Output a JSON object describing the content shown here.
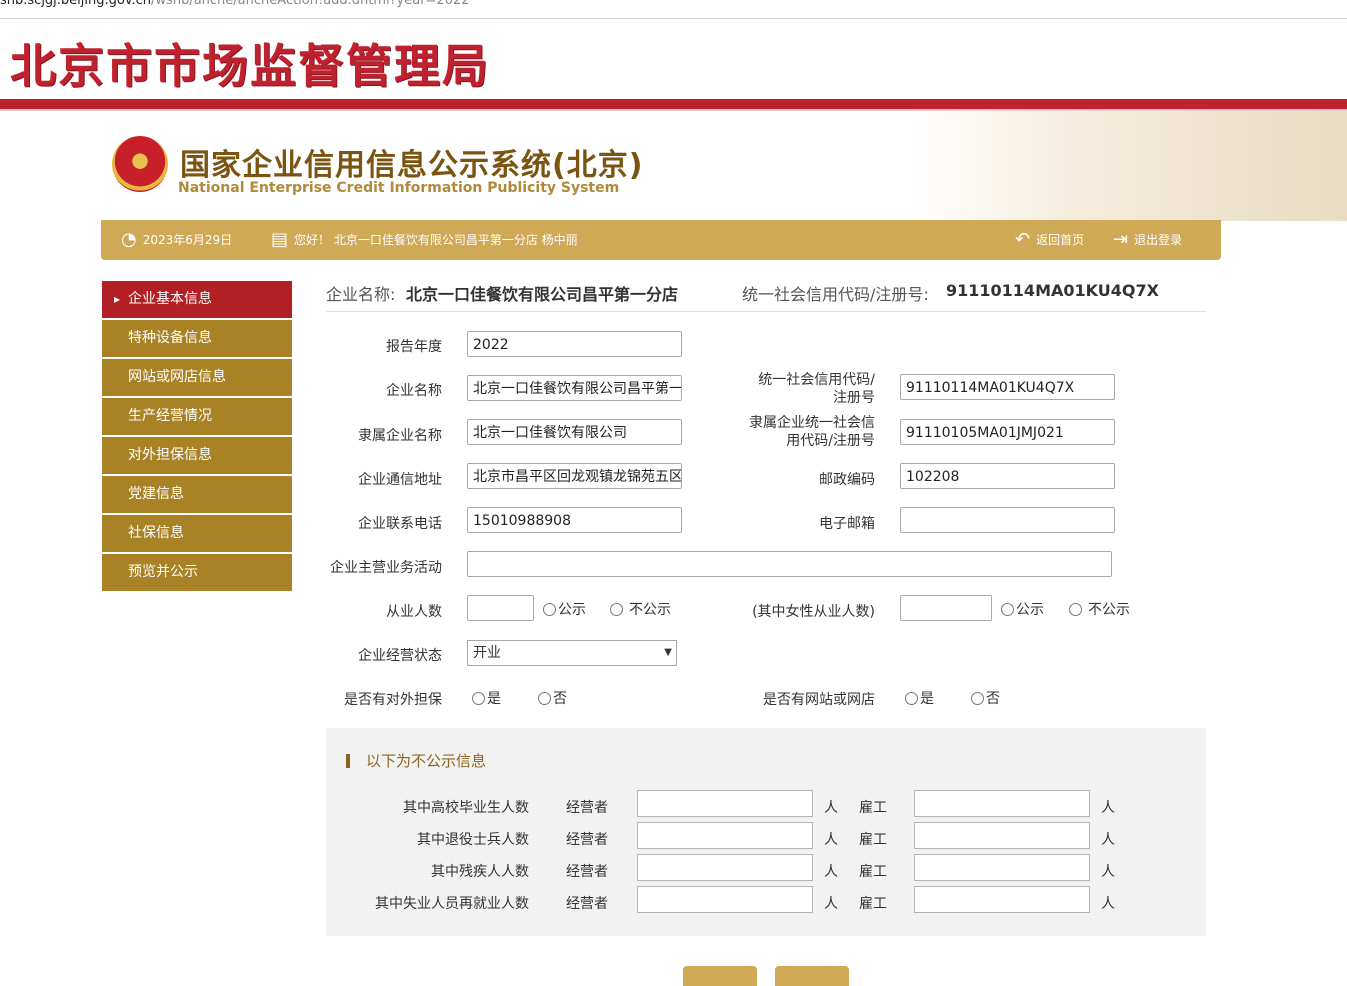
{
  "url": {
    "host": "snb.scjgj.beijing.gov.cn",
    "path": "/wsnb/anche/ancheAction!add.dhtml?year=2022"
  },
  "bureau_title": "北京市市场监督管理局",
  "system": {
    "title": "国家企业信用信息公示系统(北京)",
    "subtitle": "National Enterprise Credit Information Publicity System"
  },
  "topbar": {
    "date": "2023年6月29日",
    "greeting": "您好！ 北京一口佳餐饮有限公司昌平第一分店  杨中丽",
    "home": "返回首页",
    "logout": "退出登录"
  },
  "sidebar": {
    "items": [
      {
        "label": "企业基本信息",
        "active": true
      },
      {
        "label": "特种设备信息"
      },
      {
        "label": "网站或网店信息"
      },
      {
        "label": "生产经营情况"
      },
      {
        "label": "对外担保信息"
      },
      {
        "label": "党建信息"
      },
      {
        "label": "社保信息"
      },
      {
        "label": "预览并公示"
      }
    ]
  },
  "company_header": {
    "name_label": "企业名称:",
    "name": "北京一口佳餐饮有限公司昌平第一分店",
    "code_label": "统一社会信用代码/注册号:",
    "code": "91110114MA01KU4Q7X"
  },
  "form": {
    "report_year": {
      "label": "报告年度",
      "value": "2022"
    },
    "company_name": {
      "label": "企业名称",
      "value": "北京一口佳餐饮有限公司昌平第一"
    },
    "credit_code": {
      "label1": "统一社会信用代码/",
      "label2": "注册号",
      "value": "91110114MA01KU4Q7X"
    },
    "parent_name": {
      "label": "隶属企业名称",
      "value": "北京一口佳餐饮有限公司"
    },
    "parent_code": {
      "label1": "隶属企业统一社会信",
      "label2": "用代码/注册号",
      "value": "91110105MA01JMJ021"
    },
    "address": {
      "label": "企业通信地址",
      "value": "北京市昌平区回龙观镇龙锦苑五区"
    },
    "postcode": {
      "label": "邮政编码",
      "value": "102208"
    },
    "phone": {
      "label": "企业联系电话",
      "value": "15010988908"
    },
    "email": {
      "label": "电子邮箱",
      "value": ""
    },
    "main_business": {
      "label": "企业主营业务活动",
      "value": ""
    },
    "employees": {
      "label": "从业人数",
      "value": "",
      "opt_public": "公示",
      "opt_private": "不公示"
    },
    "female_employees": {
      "label": "(其中女性从业人数)",
      "value": "",
      "opt_public": "公示",
      "opt_private": "不公示"
    },
    "status": {
      "label": "企业经营状态",
      "value": "开业"
    },
    "guarantee": {
      "label": "是否有对外担保",
      "yes": "是",
      "no": "否"
    },
    "website": {
      "label": "是否有网站或网店",
      "yes": "是",
      "no": "否"
    }
  },
  "private_panel": {
    "title": "以下为不公示信息",
    "operator_label": "经营者",
    "employee_label": "雇工",
    "unit": "人",
    "rows": [
      {
        "label": "其中高校毕业生人数"
      },
      {
        "label": "其中退役士兵人数"
      },
      {
        "label": "其中残疾人人数"
      },
      {
        "label": "其中失业人员再就业人数"
      }
    ]
  },
  "colors": {
    "brand_red": "#c0212f",
    "gold": "#cfa955",
    "sidebar": "#a98226",
    "sidebar_active": "#b21f24"
  }
}
